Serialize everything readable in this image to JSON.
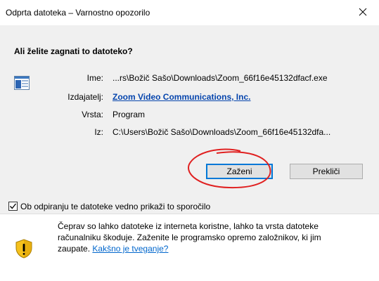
{
  "window": {
    "title": "Odprta datoteka – Varnostno opozorilo",
    "close_glyph": "✕"
  },
  "dialog": {
    "question": "Ali želite zagnati to datoteko?",
    "file_icon": "program-window-icon",
    "name_label": "Ime:",
    "name_value": "...rs\\Božič Sašo\\Downloads\\Zoom_66f16e45132dfacf.exe",
    "publisher_label": "Izdajatelj:",
    "publisher_value": "Zoom Video Communications, Inc.",
    "type_label": "Vrsta:",
    "type_value": "Program",
    "from_label": "Iz:",
    "from_value": "C:\\Users\\Božič Sašo\\Downloads\\Zoom_66f16e45132dfa...",
    "run_button": "Zaženi",
    "cancel_button": "Prekliči",
    "checkbox_checked": true,
    "checkbox_mark": "✓",
    "checkbox_label": "Ob odpiranju te datoteke vedno prikaži to sporočilo"
  },
  "warning": {
    "icon": "shield-warning-icon",
    "line1": "Čeprav so lahko datoteke iz interneta koristne, lahko ta vrsta datoteke",
    "line2": "računalniku škoduje. Zaženite le programsko opremo založnikov, ki jim",
    "line3_prefix": "zaupate.",
    "link_text": "Kakšno je tveganje?"
  },
  "colors": {
    "dialog_bg": "#f0f0f0",
    "link": "#0645ad",
    "default_button_border": "#0078d7",
    "annotation_circle": "#e02020",
    "shield_yellow": "#f5c11d"
  }
}
